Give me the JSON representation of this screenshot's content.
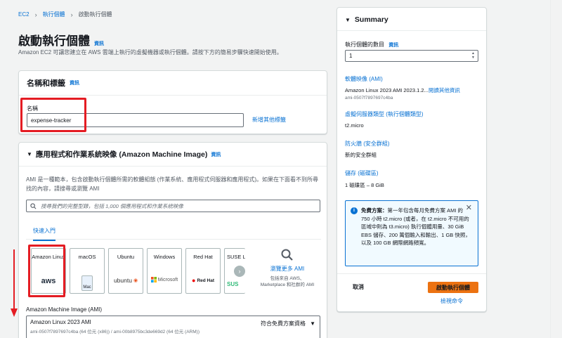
{
  "breadcrumb": {
    "items": [
      "EC2",
      "執行個體",
      "啟動執行個體"
    ]
  },
  "header": {
    "title": "啟動執行個體",
    "info": "資訊",
    "description": "Amazon EC2 可讓您建立在 AWS 雲端上執行的虛擬機器或執行個體。請按下方的簡易步驟快速開始使用。"
  },
  "name_section": {
    "title": "名稱和標籤",
    "info": "資訊",
    "field_label": "名稱",
    "field_value": "expense-tracker",
    "add_tags": "新增其他標籤"
  },
  "ami_section": {
    "title": "應用程式和作業系統映像 (Amazon Machine Image)",
    "info": "資訊",
    "description": "AMI 是一種範本，包含啟動執行個體所需的軟體組態 (作業系統、應用程式伺服器和應用程式)。如果在下面看不到所尋找的內容，請搜尋或瀏覽 AMI",
    "search_placeholder": "搜尋我們的完整型錄，包括 1,000 個應用程式和作業系統映像",
    "tab": "快速入門",
    "os_tiles": [
      {
        "name": "Amazon Linux",
        "logo": "aws"
      },
      {
        "name": "macOS",
        "logo": "Mac"
      },
      {
        "name": "Ubuntu",
        "logo": "ubuntu"
      },
      {
        "name": "Windows",
        "logo": "Microsoft"
      },
      {
        "name": "Red Hat",
        "logo": "Red Hat"
      },
      {
        "name": "SUSE Li",
        "logo": "SUS"
      }
    ],
    "browse_more": "瀏覽更多 AMI",
    "browse_sub": "包括來自 AWS、Marketplace 和社群的 AMI",
    "select_label": "Amazon Machine Image (AMI)",
    "selected_name": "Amazon Linux 2023 AMI",
    "selected_id": "ami-0507f7897697c4ba (64 位元 (x86)) / ami-00b8975bc3de669d2 (64 位元 (ARM))",
    "free_tier_badge": "符合免費方案資格"
  },
  "summary": {
    "title": "Summary",
    "count_label": "執行個體的數目",
    "count_info": "資訊",
    "count_value": "1",
    "ami_link": "軟體映像 (AMI)",
    "ami_value": "Amazon Linux 2023 AMI 2023.1.2...",
    "ami_more": "閱讀其他資訊",
    "ami_id": "ami-0507f7897697c4ba",
    "type_link": "虛擬伺服器類型 (執行個體類型)",
    "type_value": "t2.micro",
    "fw_link": "防火牆 (安全群組)",
    "fw_value": "新的安全群組",
    "storage_link": "儲存 (磁碟區)",
    "storage_value": "1 磁碟區 – 8 GiB",
    "free_tier_bold": "免費方案：",
    "free_tier_text": "第一年包含每月免費方案 AMI 的 750 小時 t2.micro (或者，在 t2.micro 不可用的區域中則為 t3.micro) 執行個體用量、30 GiB EBS 儲存、200 萬個輸入和輸出、1 GB 快照，以及 100 GB 網際網路頻寬。",
    "cancel": "取消",
    "launch": "啟動執行個體",
    "review": "檢視命令"
  },
  "colors": {
    "accent": "#0972d3",
    "primary_button": "#ec7211",
    "highlight": "#e41c23"
  }
}
